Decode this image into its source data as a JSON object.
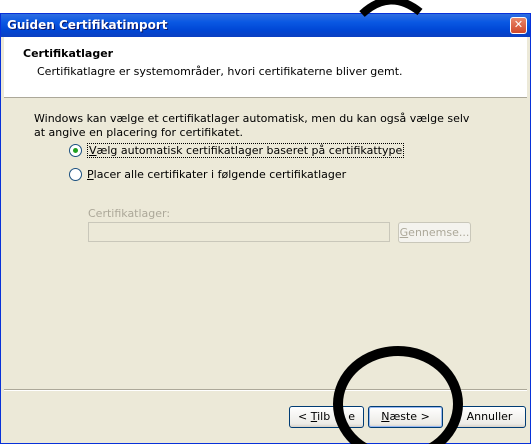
{
  "window": {
    "title": "Guiden Certifikatimport",
    "close_glyph": "✕"
  },
  "header": {
    "title": "Certifikatlager",
    "subtitle": "Certifikatlagre er systemområder, hvori certifikaterne bliver gemt."
  },
  "body": {
    "description": "Windows kan vælge et certifikatlager automatisk, men du kan også vælge selv at angive en placering for certifikatet."
  },
  "options": [
    {
      "label_mnemonic": "V",
      "label_rest": "ælg automatisk certifikatlager baseret på certifikattype",
      "checked": true
    },
    {
      "label_mnemonic": "P",
      "label_rest": "lacer alle certifikater i følgende certifikatlager",
      "checked": false
    }
  ],
  "store": {
    "label": "Certifikatlager:",
    "value": "",
    "browse_mnemonic": "G",
    "browse_rest": "ennemse..."
  },
  "buttons": {
    "back_prefix": "< ",
    "back_mnemonic": "T",
    "back_visible_rest": "ilb",
    "back_tail": "e",
    "next_mnemonic": "N",
    "next_rest": "æste >",
    "cancel": "Annuller"
  },
  "colors": {
    "titlebar": "#0a58e3",
    "dialog_bg": "#ece9d8",
    "radio_dot": "#21a121",
    "overlay_circle": "#000000"
  }
}
